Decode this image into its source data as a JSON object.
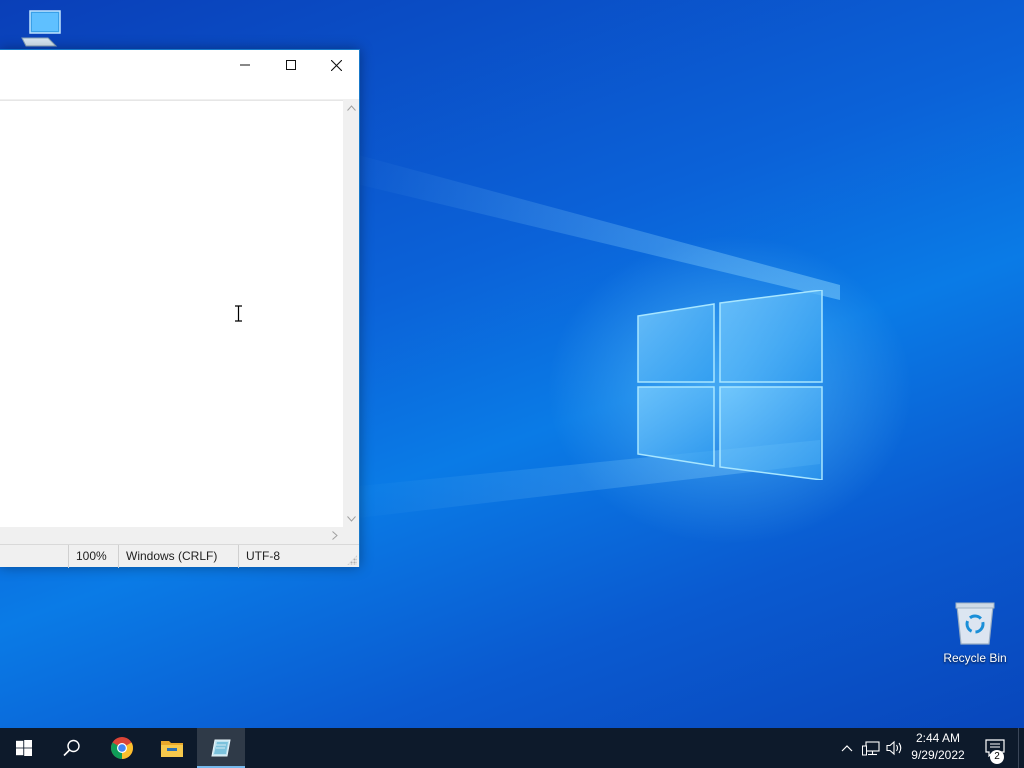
{
  "desktop": {
    "icons": [
      {
        "name": "this-pc",
        "label": ""
      },
      {
        "name": "recycle-bin",
        "label": "Recycle Bin"
      }
    ]
  },
  "notepad": {
    "status_bar": {
      "zoom": "100%",
      "line_ending": "Windows (CRLF)",
      "encoding": "UTF-8"
    }
  },
  "taskbar": {
    "items": [
      {
        "name": "start",
        "icon": "windows-logo-icon"
      },
      {
        "name": "search",
        "icon": "search-icon"
      },
      {
        "name": "chrome",
        "icon": "chrome-icon"
      },
      {
        "name": "file-explorer",
        "icon": "folder-icon"
      },
      {
        "name": "notepad",
        "icon": "notepad-icon",
        "active": true
      }
    ],
    "tray": {
      "time": "2:44 AM",
      "date": "9/29/2022",
      "notification_count": "2"
    }
  },
  "colors": {
    "taskbar_bg": "#0d1a2b",
    "active_indicator": "#76b9ed",
    "window_border": "#1979ca",
    "desktop_blue": "#0b62d8"
  }
}
